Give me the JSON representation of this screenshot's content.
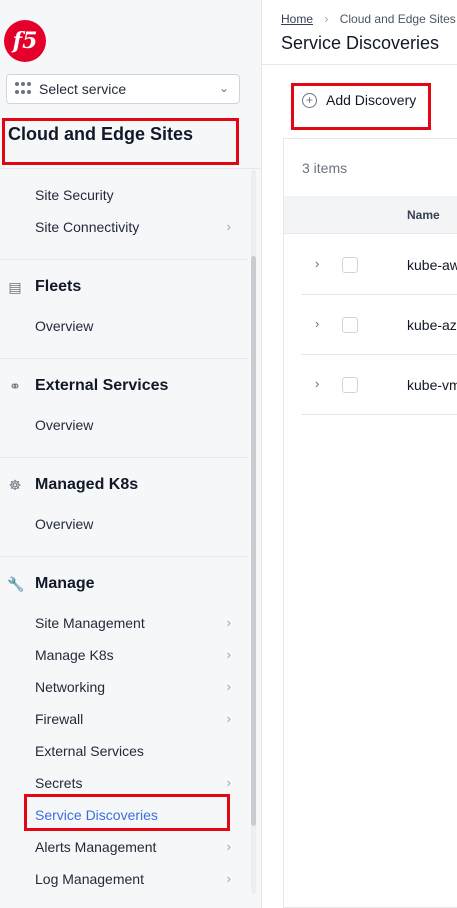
{
  "brand": {
    "logo_text": "f5"
  },
  "sidebar": {
    "select_service": "Select service",
    "section_title": "Cloud and Edge Sites",
    "top_items": [
      {
        "label": "Site Security"
      },
      {
        "label": "Site Connectivity"
      }
    ],
    "groups": [
      {
        "title": "Fleets",
        "icon": "fleets-icon",
        "items": [
          "Overview"
        ]
      },
      {
        "title": "External Services",
        "icon": "external-services-icon",
        "items": [
          "Overview"
        ]
      },
      {
        "title": "Managed K8s",
        "icon": "kubernetes-icon",
        "items": [
          "Overview"
        ]
      },
      {
        "title": "Manage",
        "icon": "wrench-icon",
        "items": [
          "Site Management",
          "Manage K8s",
          "Networking",
          "Firewall",
          "External Services",
          "Secrets",
          "Service Discoveries",
          "Alerts Management",
          "Log Management"
        ]
      }
    ],
    "active_item": "Service Discoveries"
  },
  "breadcrumb": {
    "home": "Home",
    "current": "Cloud and Edge Sites"
  },
  "page_title": "Service Discoveries",
  "toolbar": {
    "add_label": "Add Discovery"
  },
  "table": {
    "count_label": "3 items",
    "column_name": "Name",
    "rows": [
      {
        "name": "kube-aws"
      },
      {
        "name": "kube-azure"
      },
      {
        "name": "kube-vmware"
      }
    ]
  },
  "colors": {
    "accent": "#3b6fe0",
    "highlight": "#e30613",
    "brand": "#e4002b"
  }
}
